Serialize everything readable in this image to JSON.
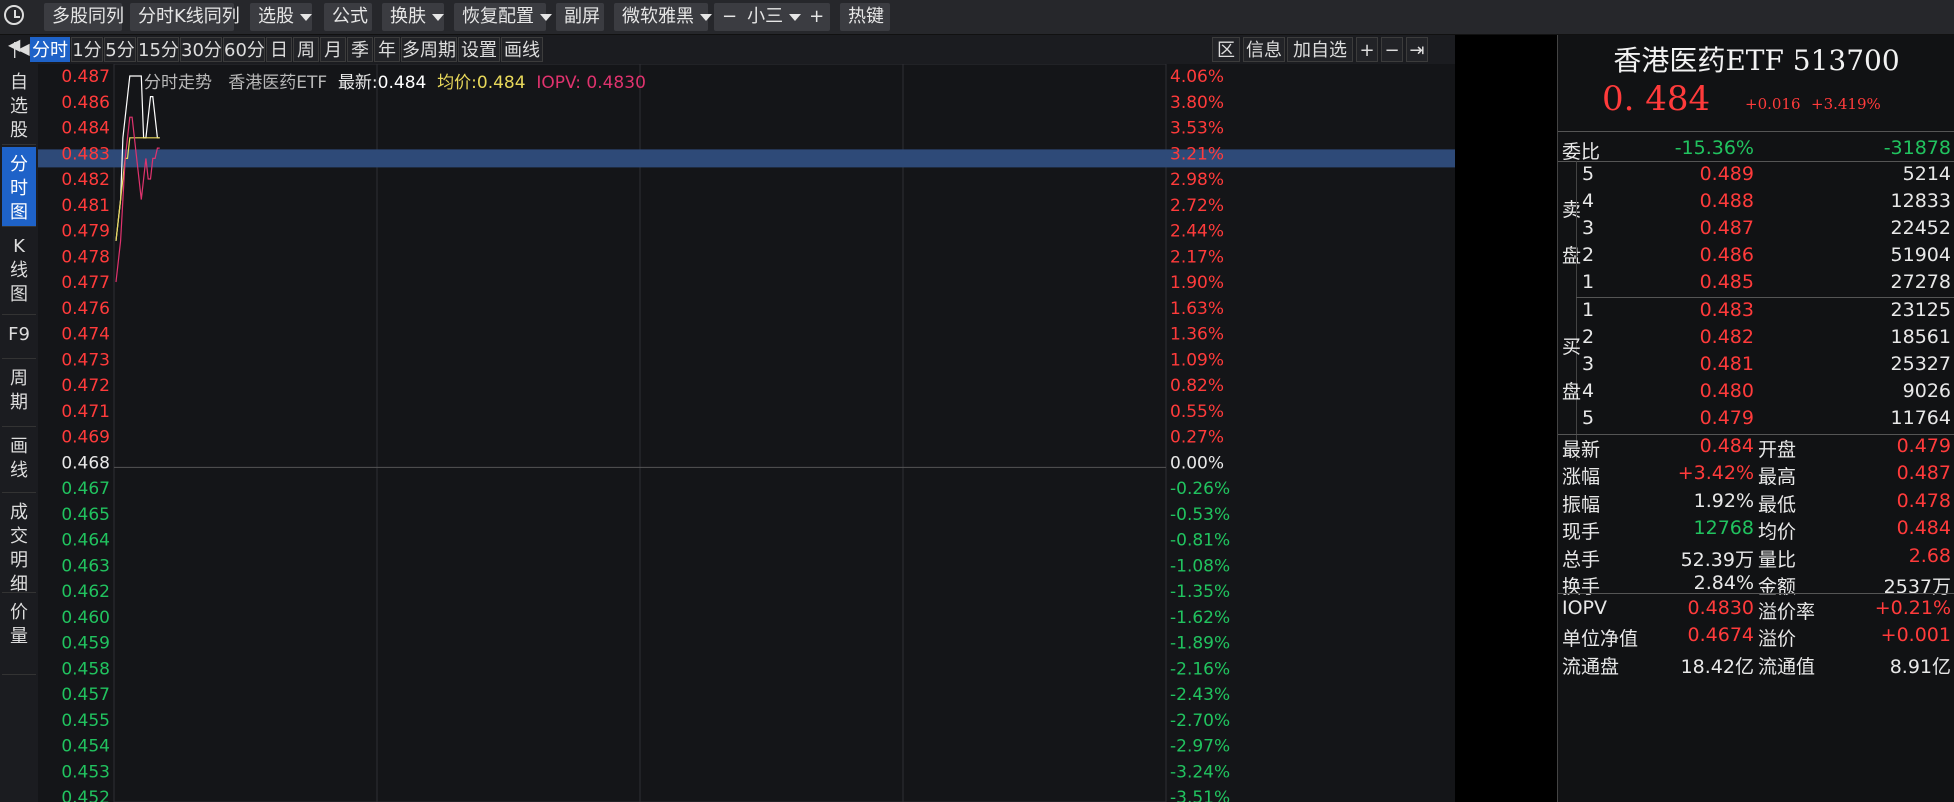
{
  "toolbar": {
    "items": [
      {
        "label": "多股同列",
        "caret": false
      },
      {
        "label": "分时K线同列",
        "caret": false
      },
      {
        "label": "选股",
        "caret": true
      },
      {
        "label": "公式",
        "caret": false
      },
      {
        "label": "换肤",
        "caret": true
      },
      {
        "label": "恢复配置",
        "caret": true
      },
      {
        "label": "副屏",
        "caret": false
      },
      {
        "label": "微软雅黑",
        "caret": true
      },
      {
        "label": "热键",
        "caret": false
      }
    ],
    "font_size": {
      "minus": "−",
      "value": "小三",
      "plus": "+"
    }
  },
  "leftnav": [
    {
      "label": "自选股",
      "active": false
    },
    {
      "label": "分时图",
      "active": true
    },
    {
      "label": "K线图",
      "active": false
    },
    {
      "label": "F9",
      "active": false
    },
    {
      "label": "周期",
      "active": false
    },
    {
      "label": "画线",
      "active": false
    },
    {
      "label": "成交明细",
      "active": false
    },
    {
      "label": "价量",
      "active": false
    }
  ],
  "periods": [
    "分时",
    "1分",
    "5分",
    "15分",
    "30分",
    "60分",
    "日",
    "周",
    "月",
    "季",
    "年",
    "多周期",
    "设置",
    "画线"
  ],
  "chart_tools": [
    "区",
    "信息",
    "加自选",
    "+",
    "−",
    "⇥"
  ],
  "legend": {
    "prefix": "分时走势",
    "name": "香港医药ETF",
    "latest_label": "最新:",
    "latest": "0.484",
    "avg_label": "均价:",
    "avg": "0.484",
    "iopv": "IOPV: 0.4830"
  },
  "chart_data": {
    "type": "line",
    "ylim": [
      0.452,
      0.487
    ],
    "prev_close": 0.468,
    "price_ticks": [
      "0.487",
      "0.486",
      "0.484",
      "0.483",
      "0.482",
      "0.481",
      "0.479",
      "0.478",
      "0.477",
      "0.476",
      "0.474",
      "0.473",
      "0.472",
      "0.471",
      "0.469",
      "0.468",
      "0.467",
      "0.465",
      "0.464",
      "0.463",
      "0.462",
      "0.460",
      "0.459",
      "0.458",
      "0.457",
      "0.455",
      "0.454",
      "0.453",
      "0.452"
    ],
    "pct_ticks": [
      "4.06%",
      "3.80%",
      "3.53%",
      "3.21%",
      "2.98%",
      "2.72%",
      "2.44%",
      "2.17%",
      "1.90%",
      "1.63%",
      "1.36%",
      "1.09%",
      "0.82%",
      "0.55%",
      "0.27%",
      "0.00%",
      "-0.26%",
      "-0.53%",
      "-0.81%",
      "-1.08%",
      "-1.35%",
      "-1.62%",
      "-1.89%",
      "-2.16%",
      "-2.43%",
      "-2.70%",
      "-2.97%",
      "-3.24%",
      "-3.51%"
    ],
    "highlight_price": "0.483",
    "highlight_pct": "3.21%",
    "series": [
      {
        "name": "最新",
        "color": "#ffffff",
        "values": [
          0.479,
          0.48,
          0.481,
          0.484,
          0.485,
          0.486,
          0.487,
          0.487,
          0.487,
          0.487,
          0.487,
          0.487,
          0.484,
          0.484,
          0.485,
          0.486,
          0.486,
          0.485,
          0.484,
          0.484
        ]
      },
      {
        "name": "均价",
        "color": "#e8d85a",
        "values": [
          0.479,
          0.48,
          0.481,
          0.482,
          0.483,
          0.483,
          0.484,
          0.484,
          0.484,
          0.484,
          0.484,
          0.484,
          0.484,
          0.484,
          0.484,
          0.484,
          0.484,
          0.484,
          0.484,
          0.484
        ]
      },
      {
        "name": "IOPV",
        "color": "#e0336e",
        "values": [
          0.477,
          0.478,
          0.479,
          0.481,
          0.483,
          0.484,
          0.485,
          0.485,
          0.484,
          0.483,
          0.482,
          0.481,
          0.482,
          0.483,
          0.482,
          0.482,
          0.483,
          0.483,
          0.4835,
          0.4835
        ]
      }
    ],
    "colors": {
      "up": "#ff3b3b",
      "down": "#21c35f",
      "flat": "#e8e8e8",
      "grid": "#2e2f34"
    }
  },
  "quote": {
    "title": "香港医药ETF 513700",
    "price": "0. 484",
    "change": "+0.016",
    "change_pct": "+3.419%",
    "weibi_label": "委比",
    "weibi": "-15.36%",
    "weicha": "-31878",
    "sell_label": [
      "卖",
      "盘"
    ],
    "buy_label": [
      "买",
      "盘"
    ],
    "asks": [
      {
        "level": "5",
        "price": "0.489",
        "volume": "5214"
      },
      {
        "level": "4",
        "price": "0.488",
        "volume": "12833"
      },
      {
        "level": "3",
        "price": "0.487",
        "volume": "22452"
      },
      {
        "level": "2",
        "price": "0.486",
        "volume": "51904"
      },
      {
        "level": "1",
        "price": "0.485",
        "volume": "27278"
      }
    ],
    "bids": [
      {
        "level": "1",
        "price": "0.483",
        "volume": "23125"
      },
      {
        "level": "2",
        "price": "0.482",
        "volume": "18561"
      },
      {
        "level": "3",
        "price": "0.481",
        "volume": "25327"
      },
      {
        "level": "4",
        "price": "0.480",
        "volume": "9026"
      },
      {
        "level": "5",
        "price": "0.479",
        "volume": "11764"
      }
    ],
    "stats": [
      {
        "l1": "最新",
        "v1": "0.484",
        "c1": "red",
        "l2": "开盘",
        "v2": "0.479",
        "c2": "red"
      },
      {
        "l1": "涨幅",
        "v1": "+3.42%",
        "c1": "red",
        "l2": "最高",
        "v2": "0.487",
        "c2": "red"
      },
      {
        "l1": "振幅",
        "v1": "1.92%",
        "c1": "white",
        "l2": "最低",
        "v2": "0.478",
        "c2": "red"
      },
      {
        "l1": "现手",
        "v1": "12768",
        "c1": "green",
        "l2": "均价",
        "v2": "0.484",
        "c2": "red"
      },
      {
        "l1": "总手",
        "v1": "52.39万",
        "c1": "white",
        "l2": "量比",
        "v2": "2.68",
        "c2": "red"
      },
      {
        "l1": "换手",
        "v1": "2.84%",
        "c1": "white",
        "l2": "金额",
        "v2": "2537万",
        "c2": "white"
      }
    ],
    "stats2": [
      {
        "l1": "IOPV",
        "v1": "0.4830",
        "c1": "red",
        "l2": "溢价率",
        "v2": "+0.21%",
        "c2": "red"
      },
      {
        "l1": "单位净值",
        "v1": "0.4674",
        "c1": "red",
        "l2": "溢价",
        "v2": "+0.001",
        "c2": "red"
      },
      {
        "l1": "流通盘",
        "v1": "18.42亿",
        "c1": "white",
        "l2": "流通值",
        "v2": "8.91亿",
        "c2": "white"
      }
    ]
  }
}
